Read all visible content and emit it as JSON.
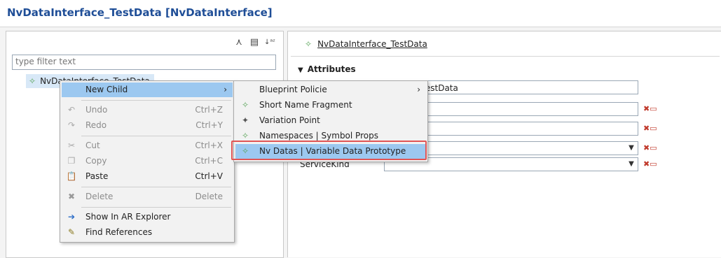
{
  "window": {
    "title": "NvDataInterface_TestData [NvDataInterface]"
  },
  "left": {
    "toolbar": {
      "icons": [
        "collapse-tree-icon",
        "document-icon",
        "sort-az-icon"
      ]
    },
    "filter": {
      "placeholder": "type filter text"
    },
    "tree": {
      "root_label": "NvDataInterface_TestData"
    }
  },
  "right": {
    "heading": "NvDataInterface_TestData",
    "section_title": "Attributes",
    "fields": {
      "name_value_visible": "terface_TestData",
      "service_kind_label": "ServiceKind"
    }
  },
  "context_menu": {
    "items": [
      {
        "label": "New Child",
        "shortcut": "",
        "submenu": true,
        "enabled": true,
        "icon": ""
      },
      {
        "label": "Undo",
        "shortcut": "Ctrl+Z",
        "enabled": false,
        "icon": "undo-icon"
      },
      {
        "label": "Redo",
        "shortcut": "Ctrl+Y",
        "enabled": false,
        "icon": "redo-icon"
      },
      {
        "label": "Cut",
        "shortcut": "Ctrl+X",
        "enabled": false,
        "icon": "cut-icon"
      },
      {
        "label": "Copy",
        "shortcut": "Ctrl+C",
        "enabled": false,
        "icon": "copy-icon"
      },
      {
        "label": "Paste",
        "shortcut": "Ctrl+V",
        "enabled": true,
        "icon": "paste-icon"
      },
      {
        "label": "Delete",
        "shortcut": "Delete",
        "enabled": false,
        "icon": "delete-icon"
      },
      {
        "label": "Show In AR Explorer",
        "shortcut": "",
        "enabled": true,
        "icon": "show-in-explorer-icon"
      },
      {
        "label": "Find References",
        "shortcut": "",
        "enabled": true,
        "icon": "find-references-icon"
      }
    ]
  },
  "submenu": {
    "items": [
      {
        "label": "Blueprint Policie",
        "submenu": true,
        "icon": ""
      },
      {
        "label": "Short Name Fragment",
        "icon": "element-icon"
      },
      {
        "label": "Variation Point",
        "icon": "variation-point-icon"
      },
      {
        "label": "Namespaces | Symbol Props",
        "icon": "element-icon"
      },
      {
        "label": "Nv Datas | Variable Data Prototype",
        "icon": "element-icon"
      }
    ]
  },
  "colors": {
    "accent": "#9cc8f0",
    "title": "#1f4e97",
    "highlight_border": "#e05555",
    "tree_selection": "#d8e8f7"
  }
}
